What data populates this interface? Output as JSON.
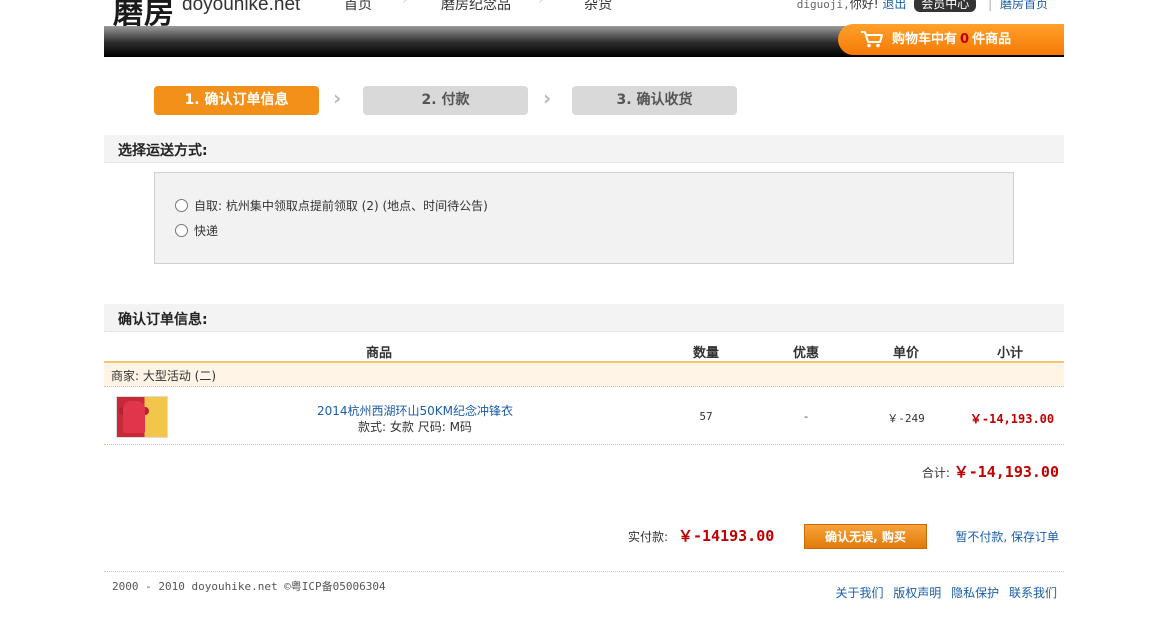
{
  "header": {
    "logo_cn": "磨房",
    "logo_en": "doyouhike.net",
    "nav": [
      "首页",
      "磨房纪念品",
      "杂货"
    ],
    "username": "diguoji,",
    "greeting": "你好!",
    "logout": "退出",
    "member_center": "会员中心",
    "home_link": "磨房首页"
  },
  "cart": {
    "prefix": "购物车中有",
    "count": "0",
    "suffix": "件商品",
    "icon": "cart-icon"
  },
  "steps": [
    "1. 确认订单信息",
    "2. 付款",
    "3. 确认收货"
  ],
  "shipping": {
    "title": "选择运送方式:",
    "options": [
      "自取: 杭州集中领取点提前领取 (2) (地点、时间待公告)",
      "快递"
    ]
  },
  "order": {
    "title": "确认订单信息:",
    "columns": [
      "商品",
      "数量",
      "优惠",
      "单价",
      "小计"
    ],
    "merchant": "商家: 大型活动 (二)",
    "item": {
      "name": "2014杭州西湖环山50KM纪念冲锋衣",
      "spec": "款式: 女款 尺码: M码",
      "quantity": "57",
      "discount": "-",
      "unit_price": "￥-249",
      "subtotal": "￥-14,193.00"
    },
    "total_label": "合计:",
    "total_value": "￥-14,193.00",
    "pay_label": "实付款:",
    "pay_value": "￥-14193.00",
    "confirm_button": "确认无误, 购买",
    "save_link": "暂不付款, 保存订单"
  },
  "footer": {
    "copyright": "2000 - 2010 doyouhike.net ©粤ICP备05006304",
    "links": [
      "关于我们",
      "版权声明",
      "隐私保护",
      "联系我们"
    ]
  },
  "colors": {
    "accent": "#f39019",
    "price": "#c00000",
    "link": "#1a5da8"
  }
}
